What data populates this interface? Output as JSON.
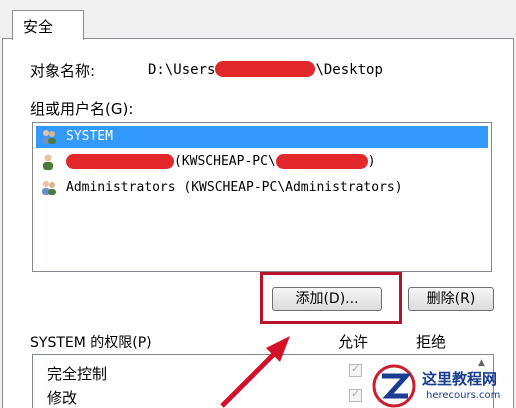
{
  "tab": {
    "label": "安全"
  },
  "object": {
    "label": "对象名称:",
    "path_prefix": "D:\\Users",
    "path_suffix": "\\Desktop"
  },
  "groups": {
    "label": "组或用户名(G):",
    "rows": [
      {
        "text": "SYSTEM"
      },
      {
        "text": "(KWSCHEAP-PC\\",
        "text_end": ")"
      },
      {
        "text": "Administrators (KWSCHEAP-PC\\Administrators)"
      }
    ]
  },
  "buttons": {
    "add": "添加(D)...",
    "remove": "删除(R)"
  },
  "permissions": {
    "label": "SYSTEM 的权限(P)",
    "allow": "允许",
    "deny": "拒绝",
    "rows": [
      {
        "name": "完全控制"
      },
      {
        "name": "修改"
      }
    ]
  },
  "watermark": {
    "title": "这里教程网",
    "url": "herecours.com"
  },
  "colors": {
    "selection": "#3399ff",
    "redaction": "#e2282b",
    "highlight": "#b7162a"
  }
}
